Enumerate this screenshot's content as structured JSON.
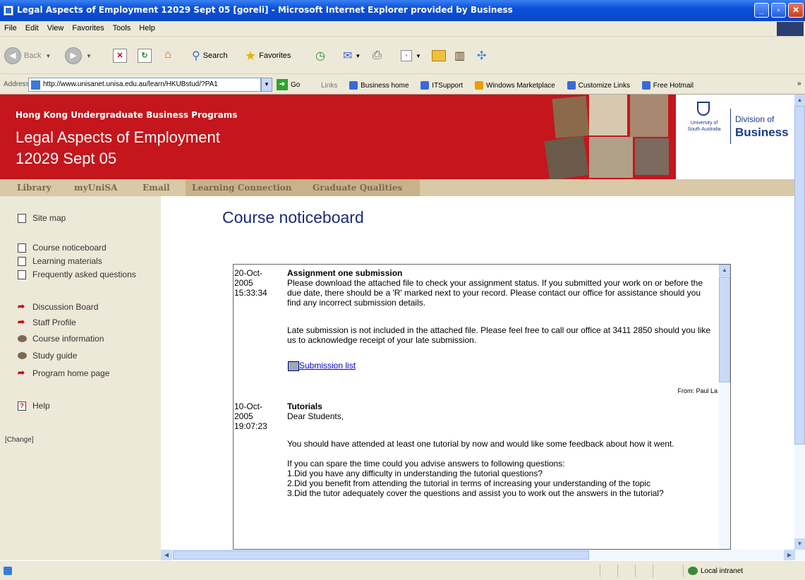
{
  "window": {
    "title": "Legal Aspects of Employment 12029 Sept 05 [goreli] - Microsoft Internet Explorer provided by Business"
  },
  "menu": [
    "File",
    "Edit",
    "View",
    "Favorites",
    "Tools",
    "Help"
  ],
  "toolbar": {
    "back": "Back",
    "search": "Search",
    "favorites": "Favorites"
  },
  "address": {
    "label": "Address",
    "url": "http://www.unisanet.unisa.edu.au/learn/HKUBstud/?PA1",
    "go": "Go"
  },
  "links": {
    "label": "Links",
    "items": [
      "Business home",
      "ITSupport",
      "Windows Marketplace",
      "Customize Links",
      "Free Hotmail"
    ],
    "more": "»"
  },
  "banner": {
    "subtitle": "Hong Kong Undergraduate Business Programs",
    "course_line1": "Legal Aspects of Employment",
    "course_line2": "12029 Sept 05",
    "uni_line1": "University of",
    "uni_line2": "South Australia",
    "division_line1": "Division of",
    "division_line2": "Business"
  },
  "nav": [
    "Library",
    "myUniSA",
    "Email",
    "Learning Connection",
    "Graduate Qualities"
  ],
  "sidebar": {
    "items": [
      {
        "label": "Site map"
      },
      {
        "label": "Course noticeboard"
      },
      {
        "label": "Learning materials"
      },
      {
        "label": "Frequently asked questions"
      },
      {
        "label": "Discussion Board"
      },
      {
        "label": "Staff Profile"
      },
      {
        "label": "Course information"
      },
      {
        "label": "Study guide"
      },
      {
        "label": "Program home page"
      },
      {
        "label": "Help"
      }
    ],
    "change": "[Change]"
  },
  "page": {
    "heading": "Course noticeboard"
  },
  "notices": [
    {
      "date": "20-Oct-",
      "year": "2005",
      "time": "15:33:34",
      "title": "Assignment one submission",
      "body1": "Please download the attached file to check your assignment status. If you submitted your work on or before the due date, there should be a 'R' marked next to your record. Please contact our office for assistance should you find any incorrect submission details.",
      "body2": "Late submission is not included in the attached file. Please feel free to call our office at 3411 2850 should you like us to acknowledge receipt of your late submission.",
      "link": "Submission list",
      "from": "From: Paul La"
    },
    {
      "date": "10-Oct-",
      "year": "2005",
      "time": "19:07:23",
      "title": "Tutorials",
      "greeting": "Dear Students,",
      "para1": "You should have attended at least one tutorial by now and would like some feedback about how it went.",
      "para2": "If you can spare the time could you advise answers to following questions:",
      "q1": "1.Did you have any difficulty in understanding the tutorial questions?",
      "q2": "2.Did you benefit from attending the tutorial in terms of increasing your understanding of the topic",
      "q3": "3.Did the tutor adequately cover the questions and assist you to work out the answers in the tutorial?"
    }
  ],
  "status": {
    "zone": "Local intranet"
  },
  "colors": {
    "banner": "#c4161c",
    "heading": "#1a2a7a",
    "nav": "#d9c9a6"
  }
}
